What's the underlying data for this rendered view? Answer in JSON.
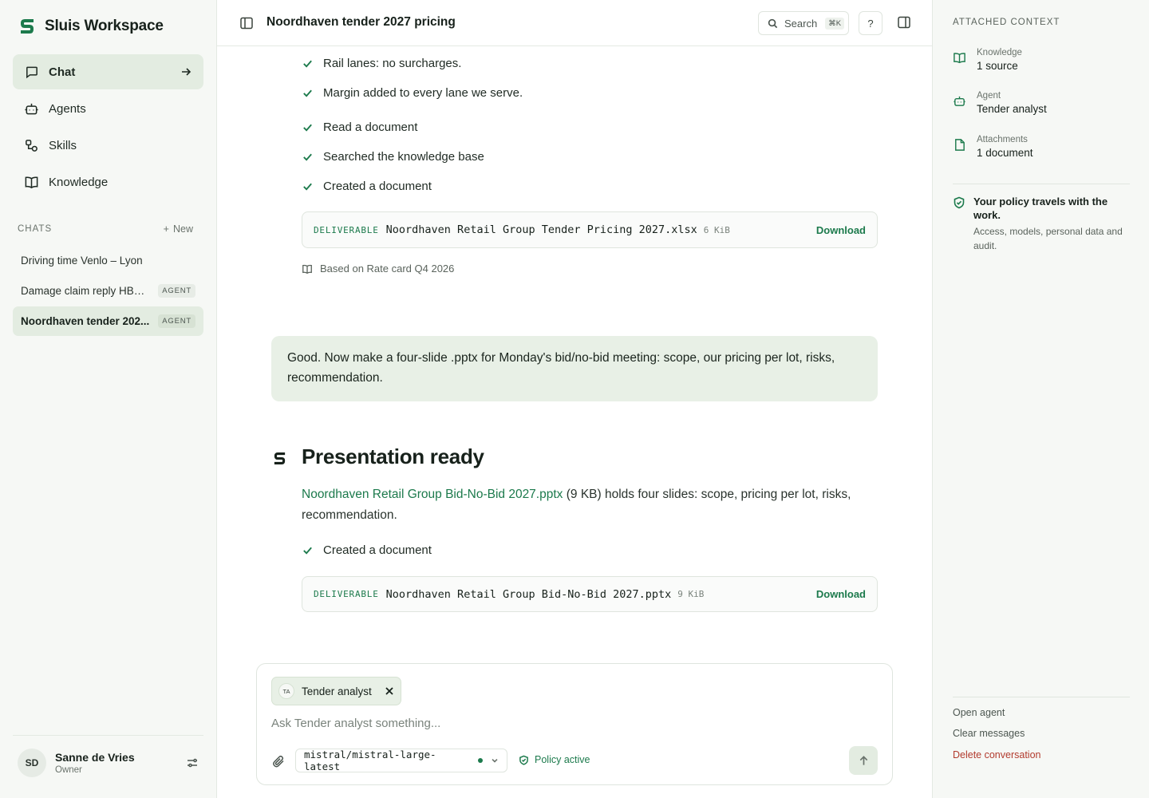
{
  "sidebar": {
    "brand": "Sluis Workspace",
    "nav": [
      {
        "label": "Chat",
        "icon": "chat-bubble-icon",
        "active": true
      },
      {
        "label": "Agents",
        "icon": "robot-icon",
        "active": false
      },
      {
        "label": "Skills",
        "icon": "skills-icon",
        "active": false
      },
      {
        "label": "Knowledge",
        "icon": "book-icon",
        "active": false
      }
    ],
    "chats_title": "CHATS",
    "new_label": "New",
    "chats": [
      {
        "label": "Driving time Venlo – Lyon",
        "badge": ""
      },
      {
        "label": "Damage claim reply HBL-...",
        "badge": "AGENT"
      },
      {
        "label": "Noordhaven tender 202...",
        "badge": "AGENT",
        "active": true
      }
    ],
    "user": {
      "initials": "SD",
      "name": "Sanne de Vries",
      "role": "Owner"
    }
  },
  "header": {
    "title": "Noordhaven tender 2027 pricing",
    "search_label": "Search",
    "search_shortcut": "⌘K",
    "help_label": "?"
  },
  "conversation": {
    "checks_top": [
      "Rail lanes: no surcharges.",
      "Margin added to every lane we serve.",
      "Read a document",
      "Searched the knowledge base",
      "Created a document"
    ],
    "deliverable_1": {
      "tag": "DELIVERABLE",
      "name": "Noordhaven Retail Group Tender Pricing 2027.xlsx",
      "size": "6 KiB",
      "action": "Download"
    },
    "based_on": "Based on Rate card Q4 2026",
    "user_message": "Good. Now make a four-slide .pptx for Monday's bid/no-bid meeting: scope, our pricing per lot, risks, recommendation.",
    "response": {
      "title": "Presentation ready",
      "link": "Noordhaven Retail Group Bid-No-Bid 2027.pptx",
      "text": " (9 KB) holds four slides: scope, pricing per lot, risks, recommendation.",
      "check": "Created a document"
    },
    "deliverable_2": {
      "tag": "DELIVERABLE",
      "name": "Noordhaven Retail Group Bid-No-Bid 2027.pptx",
      "size": "9 KiB",
      "action": "Download"
    }
  },
  "composer": {
    "chip_initials": "TA",
    "chip_label": "Tender analyst",
    "placeholder": "Ask Tender analyst something...",
    "model": "mistral/mistral-large-latest",
    "policy": "Policy active"
  },
  "right_panel": {
    "title": "ATTACHED CONTEXT",
    "items": [
      {
        "key": "Knowledge",
        "value": "1 source",
        "icon": "book-icon"
      },
      {
        "key": "Agent",
        "value": "Tender analyst",
        "icon": "robot-icon"
      },
      {
        "key": "Attachments",
        "value": "1 document",
        "icon": "document-icon"
      }
    ],
    "policy_title": "Your policy travels with the work.",
    "policy_text": "Access, models, personal data and audit.",
    "links": {
      "open_agent": "Open agent",
      "clear": "Clear messages",
      "delete": "Delete conversation"
    }
  },
  "colors": {
    "accent": "#1c7a4c",
    "danger": "#b23b2e",
    "active_bg": "#e3ece1",
    "user_msg_bg": "#e8f0e6"
  }
}
